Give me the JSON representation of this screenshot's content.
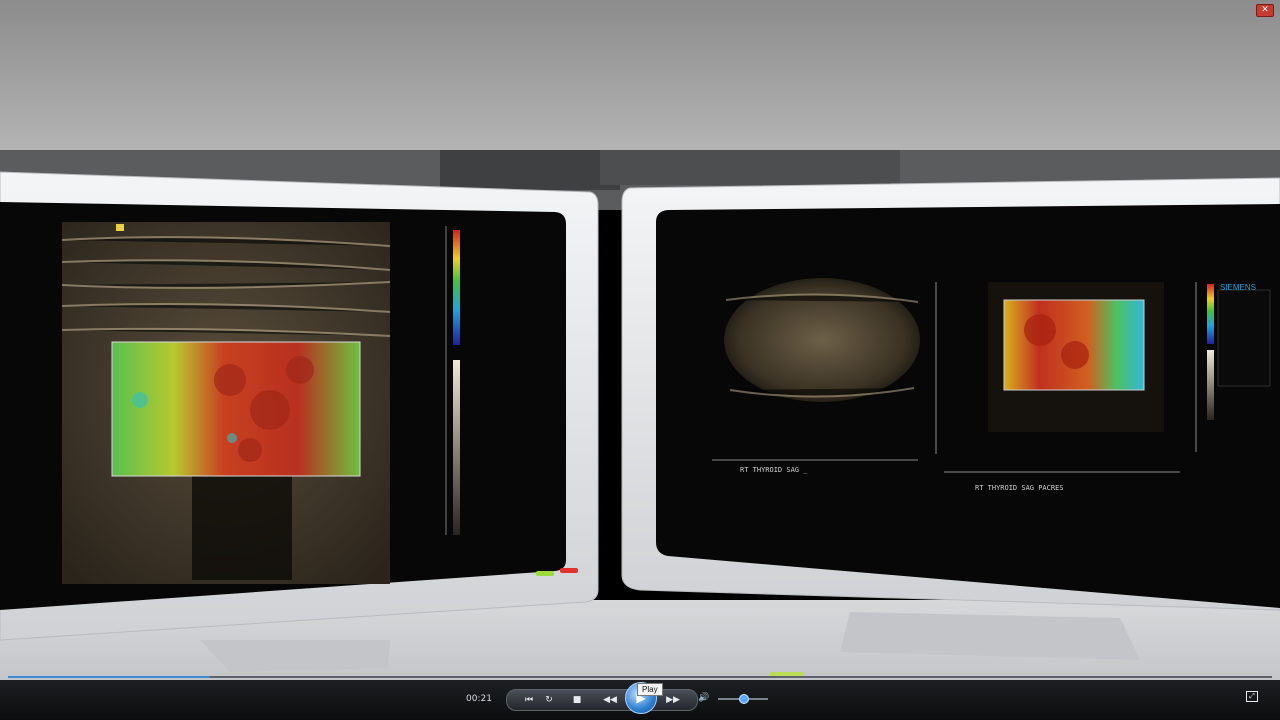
{
  "window": {
    "close_label": "✕"
  },
  "player": {
    "elapsed": "00:21",
    "progress_fraction": 0.16,
    "volume_fraction": 0.42,
    "play_tooltip": "Play",
    "icons": {
      "rewind": "⏮",
      "replay": "↻",
      "stop": "■",
      "previous": "◀◀",
      "play": "▶",
      "next": "▶▶",
      "volume": "🔊",
      "fullscreen": "⤢"
    }
  },
  "monitor_right": {
    "left_image_caption": "RT THYROID SAG _",
    "right_image_caption": "RT THYROID SAG PACRES",
    "brand": "SIEMENS"
  },
  "colors": {
    "wall": "#9a9a9a",
    "bezel": "#e8e9eb",
    "screen": "#070707",
    "led_green": "#9bdc3a",
    "led_red": "#e0342a",
    "accent": "#3c8ad6"
  }
}
